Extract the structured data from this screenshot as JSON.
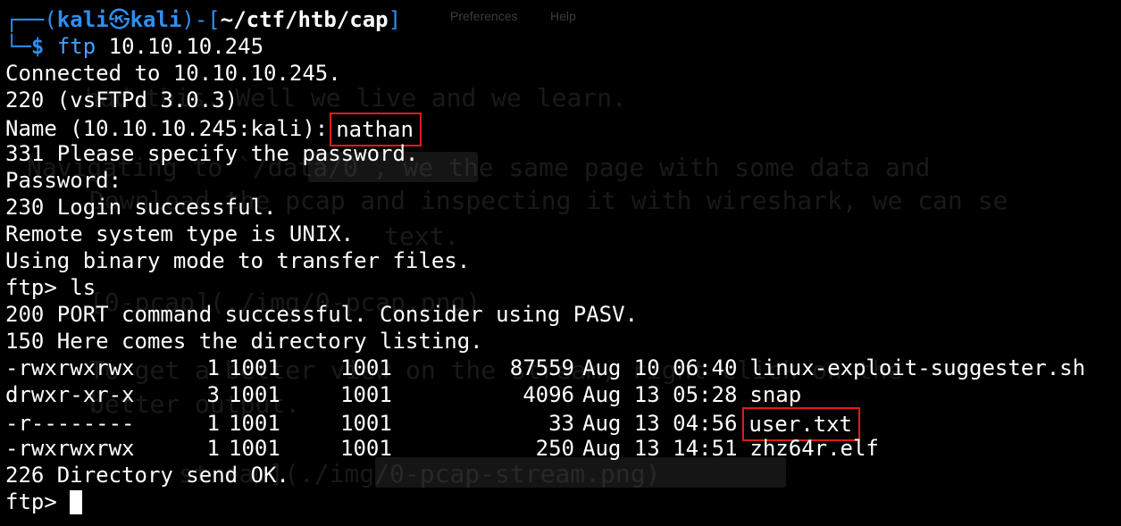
{
  "prompt": {
    "user": "kali",
    "host": "kali",
    "cwd": "~/ctf/htb/cap",
    "symbol": "$",
    "command": "ftp",
    "argument": "10.10.10.245"
  },
  "session": {
    "connected": "Connected to 10.10.10.245.",
    "banner": "220 (vsFTPd 3.0.3)",
    "name_prompt": "Name (10.10.10.245:kali):",
    "name_value": "nathan",
    "password_request": "331 Please specify the password.",
    "password_prompt": "Password:",
    "login_ok": "230 Login successful.",
    "system_type": "Remote system type is UNIX.",
    "binary_mode": "Using binary mode to transfer files.",
    "ls_prompt": "ftp>",
    "ls_command": "ls",
    "port_ok": "200 PORT command successful. Consider using PASV.",
    "listing_start": "150 Here comes the directory listing.",
    "listing_end": "226 Directory send OK.",
    "final_prompt": "ftp>"
  },
  "listing": [
    {
      "perms": "-rwxrwxrwx",
      "links": "1",
      "owner": "1001",
      "group": "1001",
      "size": "87559",
      "date": "Aug 10 06:40",
      "name": "linux-exploit-suggester.sh"
    },
    {
      "perms": "drwxr-xr-x",
      "links": "3",
      "owner": "1001",
      "group": "1001",
      "size": "4096",
      "date": "Aug 13 05:28",
      "name": "snap"
    },
    {
      "perms": "-r--------",
      "links": "1",
      "owner": "1001",
      "group": "1001",
      "size": "33",
      "date": "Aug 13 04:56",
      "name": "user.txt"
    },
    {
      "perms": "-rwxrwxrwx",
      "links": "1",
      "owner": "1001",
      "group": "1001",
      "size": "250",
      "date": "Aug 13 14:51",
      "name": "zhz64r.elf"
    }
  ],
  "background": {
    "menu": [
      "Preferences",
      "Help"
    ],
    "lines": [
      "had this. Well we live and we learn.",
      "Navigating to `/data/0`, we the same page with some data and",
      "Download the pcap and inspecting it with wireshark, we can se",
      "text.",
      "[0-pcap](./img/0-pcap.png)",
      "To get a better view on the stream, right click on the",
      "better output.",
      "stream](./img/0-pcap-stream.png)"
    ]
  },
  "colors": {
    "background": "#000000",
    "prompt": "#2f8ff0",
    "command": "#3ea4ff",
    "text": "#ffffff",
    "highlight": "#e01b1b"
  }
}
